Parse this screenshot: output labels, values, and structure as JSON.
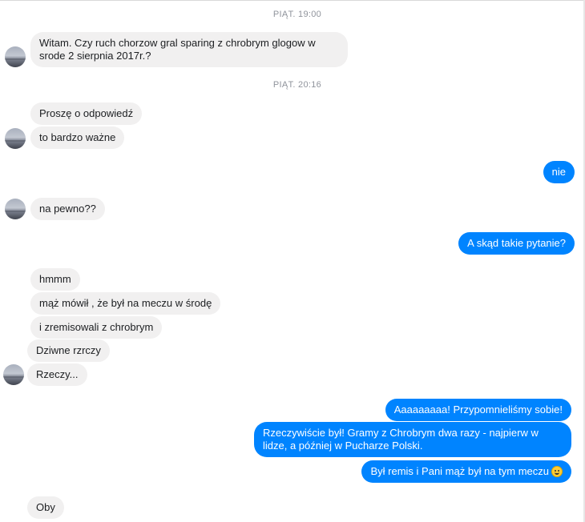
{
  "conversation": {
    "timestamps": [
      "PIĄT. 19:00",
      "PIĄT. 20:16"
    ],
    "messages": [
      {
        "from": "them",
        "text": "Witam. Czy ruch chorzow gral sparing z chrobrym glogow w srode 2 sierpnia 2017r.?"
      },
      {
        "from": "them",
        "text": "Proszę o odpowiedź"
      },
      {
        "from": "them",
        "text": "to bardzo ważne"
      },
      {
        "from": "me",
        "text": "nie"
      },
      {
        "from": "them",
        "text": "na pewno??"
      },
      {
        "from": "me",
        "text": "A skąd takie pytanie?"
      },
      {
        "from": "them",
        "text": "hmmm"
      },
      {
        "from": "them",
        "text": "mąż mówił , że był na meczu w środę"
      },
      {
        "from": "them",
        "text": "i zremisowali z chrobrym"
      },
      {
        "from": "them",
        "text": "Dziwne rzrczy"
      },
      {
        "from": "them",
        "text": "Rzeczy..."
      },
      {
        "from": "me",
        "text": "Aaaaaaaaa! Przypomnieliśmy sobie!"
      },
      {
        "from": "me",
        "text": "Rzeczywiście był! Gramy z Chrobrym dwa razy - najpierw w lidze, a później w Pucharze Polski."
      },
      {
        "from": "me",
        "text": "Był remis i Pani mąż był na tym meczu",
        "emoji": "grinning-face"
      },
      {
        "from": "them",
        "text": "Oby"
      }
    ]
  },
  "colors": {
    "outgoing_bubble": "#0084ff",
    "incoming_bubble": "#f1f0f0",
    "timestamp": "#90949c"
  }
}
